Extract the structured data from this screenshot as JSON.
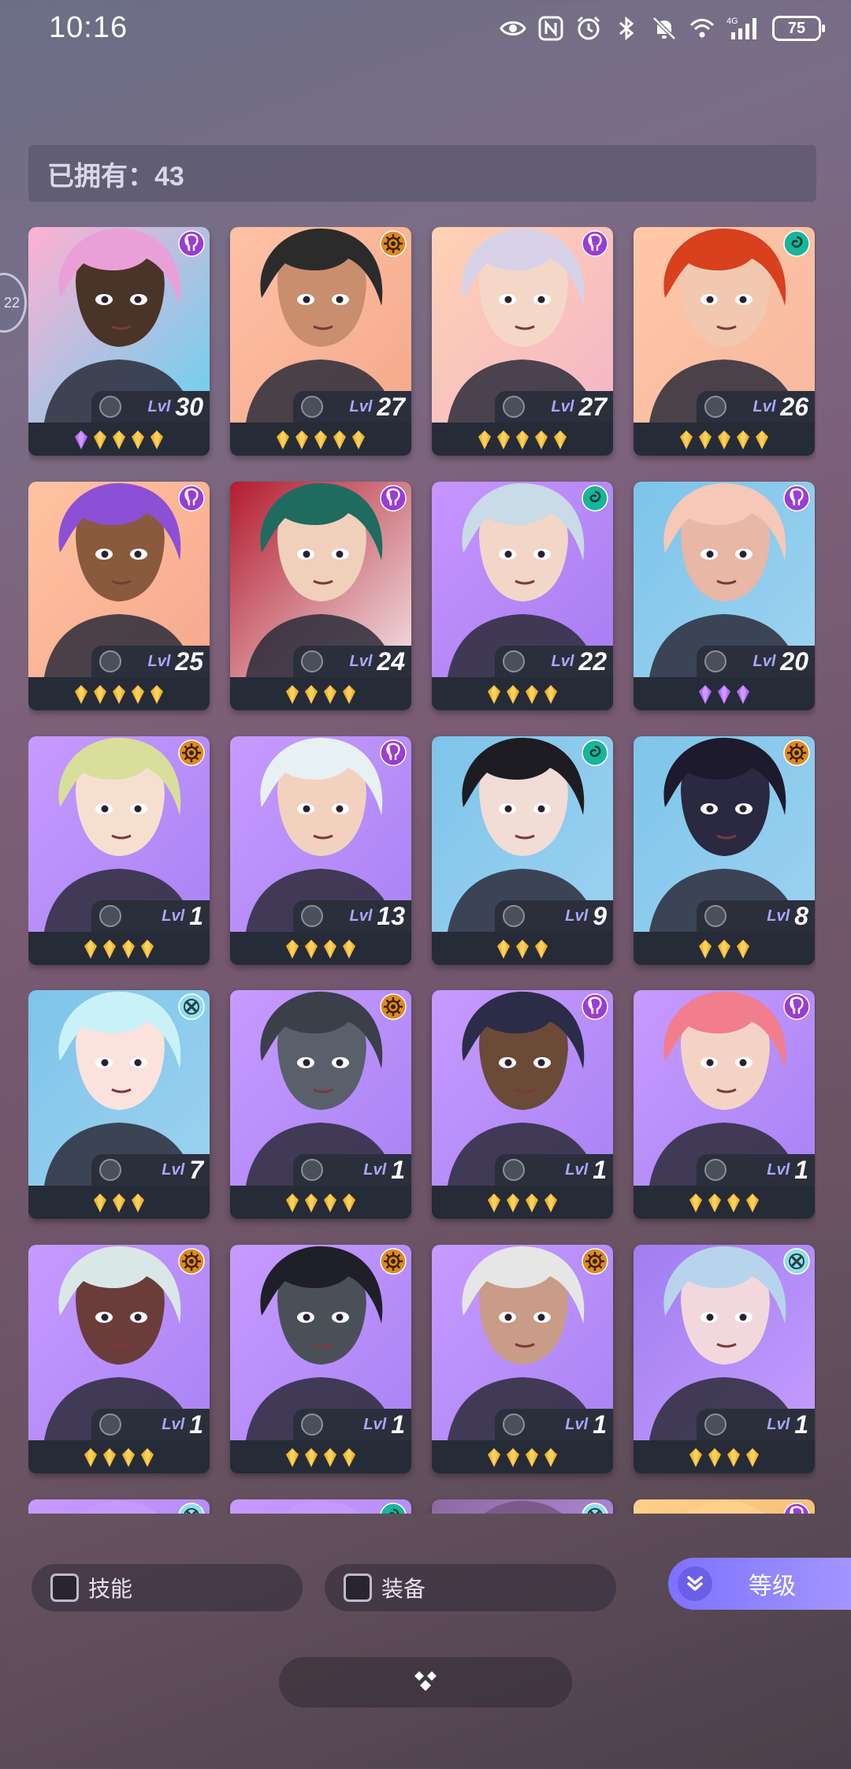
{
  "status_bar": {
    "time": "10:16",
    "battery": "75",
    "icons": [
      "eye-icon",
      "nfc-icon",
      "alarm-icon",
      "bluetooth-icon",
      "mute-icon",
      "wifi-icon",
      "signal-icon"
    ],
    "network": "4G"
  },
  "side_tab": {
    "label": "22"
  },
  "owned": {
    "label": "已拥有：43"
  },
  "colors": {
    "gold_gem": "#f3b62a",
    "purple_gem": "#b46bff",
    "lvl_label": "#a6a9ff",
    "class_purple": "#9b3cd6",
    "class_orange": "#e08a1a",
    "class_teal": "#17b59a",
    "class_cyan": "#8fe0ea",
    "accent": "#8c80ff"
  },
  "heroes": [
    {
      "lvl_label": "Lvl",
      "level": "30",
      "class_icon": "purple",
      "gems": [
        "purple",
        "gold",
        "gold",
        "gold",
        "gold"
      ],
      "skin": "#4a3427",
      "hair": "#e9a0d8",
      "bg": [
        "#ffb0d2",
        "#69d1f0"
      ]
    },
    {
      "lvl_label": "Lvl",
      "level": "27",
      "class_icon": "orange",
      "gems": [
        "gold",
        "gold",
        "gold",
        "gold",
        "gold"
      ],
      "skin": "#c98e6e",
      "hair": "#2b2b2b",
      "bg": [
        "#ffc1a6",
        "#f4a98a"
      ]
    },
    {
      "lvl_label": "Lvl",
      "level": "27",
      "class_icon": "purple",
      "gems": [
        "gold",
        "gold",
        "gold",
        "gold",
        "gold"
      ],
      "skin": "#f5d7c8",
      "hair": "#d8d2e8",
      "bg": [
        "#ffd2b3",
        "#f4b6c8"
      ]
    },
    {
      "lvl_label": "Lvl",
      "level": "26",
      "class_icon": "teal",
      "gems": [
        "gold",
        "gold",
        "gold",
        "gold",
        "gold"
      ],
      "skin": "#f2c8b0",
      "hair": "#d8401e",
      "bg": [
        "#ffc8a8",
        "#f7b89f"
      ]
    },
    {
      "lvl_label": "Lvl",
      "level": "25",
      "class_icon": "purple",
      "gems": [
        "gold",
        "gold",
        "gold",
        "gold",
        "gold"
      ],
      "skin": "#8a5a3e",
      "hair": "#8c4fd6",
      "bg": [
        "#ffc3a0",
        "#f6a88d"
      ]
    },
    {
      "lvl_label": "Lvl",
      "level": "24",
      "class_icon": "purple",
      "gems": [
        "gold",
        "gold",
        "gold",
        "gold"
      ],
      "skin": "#f0d0bb",
      "hair": "#1f6b60",
      "bg": [
        "#b21c2e",
        "#f3e4e6"
      ]
    },
    {
      "lvl_label": "Lvl",
      "level": "22",
      "class_icon": "teal",
      "gems": [
        "gold",
        "gold",
        "gold",
        "gold"
      ],
      "skin": "#f2d6c8",
      "hair": "#c8dbe6",
      "bg": [
        "#c796ff",
        "#a77cf0"
      ]
    },
    {
      "lvl_label": "Lvl",
      "level": "20",
      "class_icon": "purple",
      "gems": [
        "purple",
        "purple",
        "purple"
      ],
      "skin": "#e8b7a5",
      "hair": "#f5c8b8",
      "bg": [
        "#7cc4ea",
        "#9fd3f0"
      ]
    },
    {
      "lvl_label": "Lvl",
      "level": "1",
      "class_icon": "orange",
      "gems": [
        "gold",
        "gold",
        "gold",
        "gold"
      ],
      "skin": "#f7dfd0",
      "hair": "#d7df9a",
      "bg": [
        "#c79aff",
        "#a983f5"
      ]
    },
    {
      "lvl_label": "Lvl",
      "level": "13",
      "class_icon": "purple",
      "gems": [
        "gold",
        "gold",
        "gold",
        "gold"
      ],
      "skin": "#f2d1bf",
      "hair": "#e7f0f2",
      "bg": [
        "#c79aff",
        "#a983f5"
      ]
    },
    {
      "lvl_label": "Lvl",
      "level": "9",
      "class_icon": "teal",
      "gems": [
        "gold",
        "gold",
        "gold"
      ],
      "skin": "#f1dcd6",
      "hair": "#1c1c22",
      "bg": [
        "#7ec4ea",
        "#9cd2f0"
      ]
    },
    {
      "lvl_label": "Lvl",
      "level": "8",
      "class_icon": "orange",
      "gems": [
        "gold",
        "gold",
        "gold"
      ],
      "skin": "#2b2842",
      "hair": "#1c1a2c",
      "bg": [
        "#7ec4ea",
        "#9cd2f0"
      ]
    },
    {
      "lvl_label": "Lvl",
      "level": "7",
      "class_icon": "cyan",
      "gems": [
        "gold",
        "gold",
        "gold"
      ],
      "skin": "#fbe2dc",
      "hair": "#c9f2f8",
      "bg": [
        "#7ec4ea",
        "#9cd2f0"
      ]
    },
    {
      "lvl_label": "Lvl",
      "level": "1",
      "class_icon": "orange",
      "gems": [
        "gold",
        "gold",
        "gold",
        "gold"
      ],
      "skin": "#59606b",
      "hair": "#3a3f4a",
      "bg": [
        "#c79aff",
        "#a983f5"
      ]
    },
    {
      "lvl_label": "Lvl",
      "level": "1",
      "class_icon": "purple",
      "gems": [
        "gold",
        "gold",
        "gold",
        "gold"
      ],
      "skin": "#6b4a38",
      "hair": "#2b2c47",
      "bg": [
        "#c79aff",
        "#a983f5"
      ]
    },
    {
      "lvl_label": "Lvl",
      "level": "1",
      "class_icon": "purple",
      "gems": [
        "gold",
        "gold",
        "gold",
        "gold"
      ],
      "skin": "#f5d3c4",
      "hair": "#f27d8c",
      "bg": [
        "#c79aff",
        "#a983f5"
      ]
    },
    {
      "lvl_label": "Lvl",
      "level": "1",
      "class_icon": "orange",
      "gems": [
        "gold",
        "gold",
        "gold",
        "gold"
      ],
      "skin": "#6b3d3a",
      "hair": "#d9e8e6",
      "bg": [
        "#c79aff",
        "#a983f5"
      ]
    },
    {
      "lvl_label": "Lvl",
      "level": "1",
      "class_icon": "orange",
      "gems": [
        "gold",
        "gold",
        "gold",
        "gold"
      ],
      "skin": "#4b5058",
      "hair": "#1f1f2a",
      "bg": [
        "#c79aff",
        "#a983f5"
      ]
    },
    {
      "lvl_label": "Lvl",
      "level": "1",
      "class_icon": "orange",
      "gems": [
        "gold",
        "gold",
        "gold",
        "gold"
      ],
      "skin": "#c89c86",
      "hair": "#e6e6e6",
      "bg": [
        "#c79aff",
        "#a983f5"
      ]
    },
    {
      "lvl_label": "Lvl",
      "level": "1",
      "class_icon": "cyan",
      "gems": [
        "gold",
        "gold",
        "gold",
        "gold"
      ],
      "skin": "#f2d8dc",
      "hair": "#b8d4ec",
      "bg": [
        "#a07ef0",
        "#c59cff"
      ]
    },
    {
      "lvl_label": "",
      "level": "",
      "class_icon": "cyan",
      "gems": [],
      "skin": "#c79aff",
      "hair": "#c79aff",
      "bg": [
        "#c79aff",
        "#a983f5"
      ]
    },
    {
      "lvl_label": "",
      "level": "",
      "class_icon": "teal",
      "gems": [],
      "skin": "#c79aff",
      "hair": "#c79aff",
      "bg": [
        "#c79aff",
        "#a983f5"
      ]
    },
    {
      "lvl_label": "",
      "level": "",
      "class_icon": "cyan",
      "gems": [],
      "skin": "#7c5a8c",
      "hair": "#7c5a8c",
      "bg": [
        "#8c6aa0",
        "#c79aff"
      ]
    },
    {
      "lvl_label": "",
      "level": "",
      "class_icon": "purple",
      "gems": [],
      "skin": "#ffd08a",
      "hair": "#ffd08a",
      "bg": [
        "#ffd08a",
        "#f2b36a"
      ]
    }
  ],
  "filters": {
    "skill_label": "技能",
    "equipment_label": "装备",
    "level_sort_label": "等级"
  },
  "bottom_pill": {
    "icon": "diamond-cluster-icon"
  }
}
